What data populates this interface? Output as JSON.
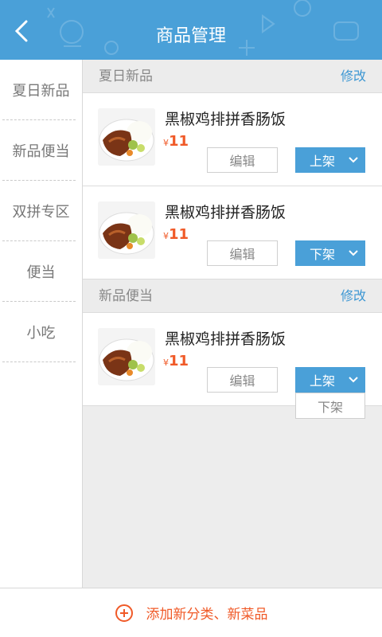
{
  "header": {
    "title": "商品管理",
    "back_icon": "back-arrow-icon",
    "color": "#4aa0d8"
  },
  "sidebar": {
    "items": [
      {
        "label": "夏日新品"
      },
      {
        "label": "新品便当"
      },
      {
        "label": "双拼专区"
      },
      {
        "label": "便当"
      },
      {
        "label": "小吃"
      }
    ]
  },
  "categories": [
    {
      "title": "夏日新品",
      "edit_label": "修改",
      "products": [
        {
          "name": "黑椒鸡排拼香肠饭",
          "currency": "¥",
          "price": "11",
          "edit_label": "编辑",
          "status_label": "上架"
        },
        {
          "name": "黑椒鸡排拼香肠饭",
          "currency": "¥",
          "price": "11",
          "edit_label": "编辑",
          "status_label": "下架"
        }
      ]
    },
    {
      "title": "新品便当",
      "edit_label": "修改",
      "products": [
        {
          "name": "黑椒鸡排拼香肠饭",
          "currency": "¥",
          "price": "11",
          "edit_label": "编辑",
          "status_label": "上架",
          "dropdown_option": "下架"
        }
      ]
    }
  ],
  "footer": {
    "add_label": "添加新分类、新菜品",
    "add_icon": "plus-circle-icon",
    "accent": "#f05a28"
  }
}
